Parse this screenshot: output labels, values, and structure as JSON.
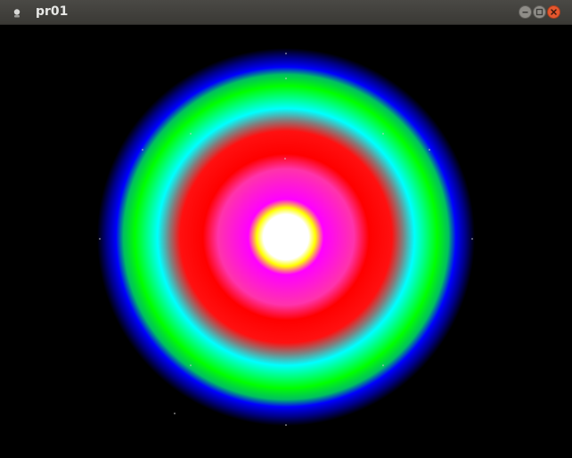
{
  "window": {
    "title": "pr01",
    "icons": {
      "app": "app-icon",
      "minimize": "minimize-icon",
      "maximize": "maximize-icon",
      "close": "close-icon"
    }
  },
  "canvas": {
    "background": "#000000",
    "gradient_colors": [
      "#ffffff",
      "#ffff00",
      "#ff00ff",
      "#ff0000",
      "#00ffff",
      "#00ff00",
      "#0000ff",
      "#000000"
    ]
  }
}
